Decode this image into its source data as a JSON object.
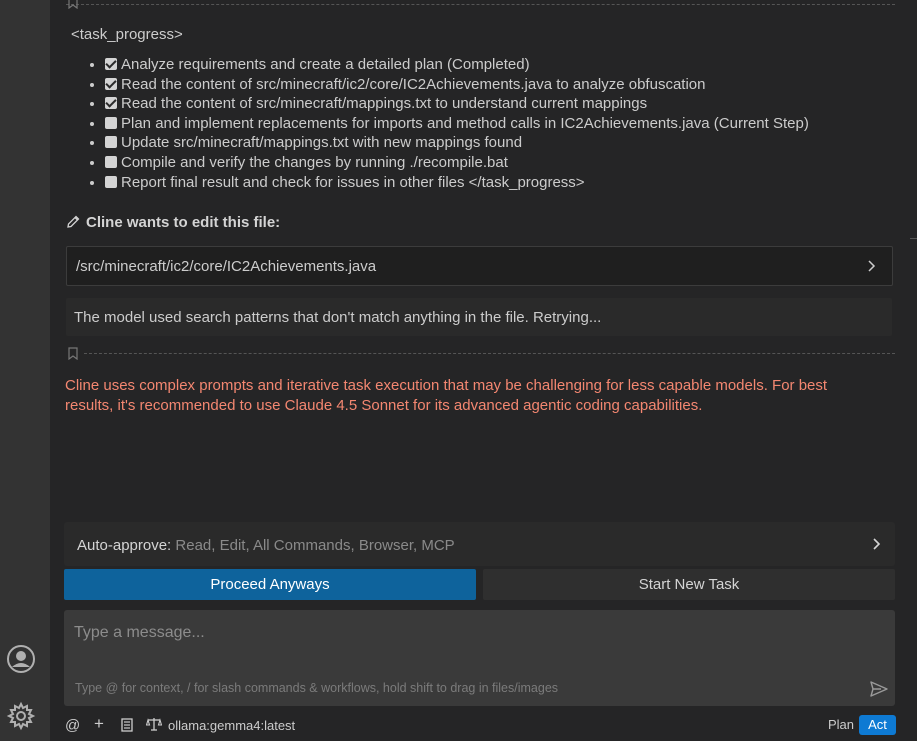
{
  "task_progress": {
    "open_tag": "<task_progress>",
    "items": [
      {
        "text": "Analyze requirements and create a detailed plan (Completed)",
        "checked": true
      },
      {
        "text": "Read the content of src/minecraft/ic2/core/IC2Achievements.java to analyze obfuscation",
        "checked": true
      },
      {
        "text": "Read the content of src/minecraft/mappings.txt to understand current mappings",
        "checked": true
      },
      {
        "text": "Plan and implement replacements for imports and method calls in IC2Achievements.java (Current Step)",
        "checked": false
      },
      {
        "text": "Update src/minecraft/mappings.txt with new mappings found",
        "checked": false
      },
      {
        "text": "Compile and verify the changes by running ./recompile.bat",
        "checked": false
      },
      {
        "text": "Report final result and check for issues in other files </task_progress>",
        "checked": false
      }
    ]
  },
  "edit": {
    "title": "Cline wants to edit this file:",
    "file_path": "/src/minecraft/ic2/core/IC2Achievements.java",
    "status_message": "The model used search patterns that don't match anything in the file. Retrying..."
  },
  "warning": {
    "text": "Cline uses complex prompts and iterative task execution that may be challenging for less capable models. For best results, it's recommended to use Claude 4.5 Sonnet for its advanced agentic coding capabilities.",
    "color": "#f48771"
  },
  "auto_approve": {
    "label": "Auto-approve:",
    "value": "Read, Edit, All Commands, Browser, MCP"
  },
  "buttons": {
    "proceed": "Proceed Anyways",
    "new_task": "Start New Task"
  },
  "input": {
    "placeholder": "Type a message...",
    "hint": "Type @ for context, / for slash commands & workflows, hold shift to drag in files/images"
  },
  "bottom_bar": {
    "at_symbol": "@",
    "plus_symbol": "+",
    "model": "ollama:gemma4:latest",
    "mode_plan": "Plan",
    "mode_act": "Act"
  },
  "colors": {
    "accent": "#0e639c",
    "act_active": "#0e7ad3",
    "background": "#252526"
  }
}
